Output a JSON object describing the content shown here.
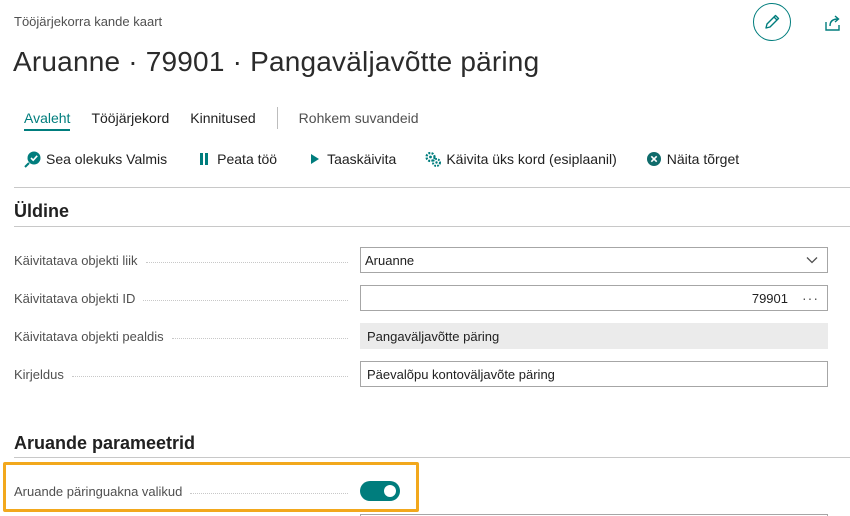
{
  "page": {
    "caption": "Tööjärjekorra kande kaart",
    "title": "Aruanne · 79901 · Pangaväljavõtte päring"
  },
  "tabs": [
    {
      "label": "Avaleht",
      "active": true
    },
    {
      "label": "Tööjärjekord",
      "active": false
    },
    {
      "label": "Kinnitused",
      "active": false
    },
    {
      "label": "Rohkem suvandeid",
      "active": false
    }
  ],
  "actions": [
    {
      "label": "Sea olekuks Valmis",
      "icon": "status-ready-icon"
    },
    {
      "label": "Peata töö",
      "icon": "pause-icon"
    },
    {
      "label": "Taaskäivita",
      "icon": "play-icon"
    },
    {
      "label": "Käivita üks kord (esiplaanil)",
      "icon": "run-gears-icon"
    },
    {
      "label": "Näita tõrget",
      "icon": "error-circle-icon"
    }
  ],
  "general": {
    "heading": "Üldine",
    "fields": [
      {
        "label": "Käivitatava objekti liik",
        "value": "Aruanne"
      },
      {
        "label": "Käivitatava objekti ID",
        "value": "79901",
        "lookup": "···"
      },
      {
        "label": "Käivitatava objekti pealdis",
        "value": "Pangaväljavõtte päring"
      },
      {
        "label": "Kirjeldus",
        "value": "Päevalõpu kontoväljavõte päring"
      }
    ]
  },
  "report_params": {
    "heading": "Aruande parameetrid",
    "toggle_label": "Aruande päringuakna valikud",
    "toggle_on": true
  },
  "colors": {
    "accent": "#007d7d",
    "highlight": "#f2a81d",
    "error": "#0f6b6b"
  }
}
